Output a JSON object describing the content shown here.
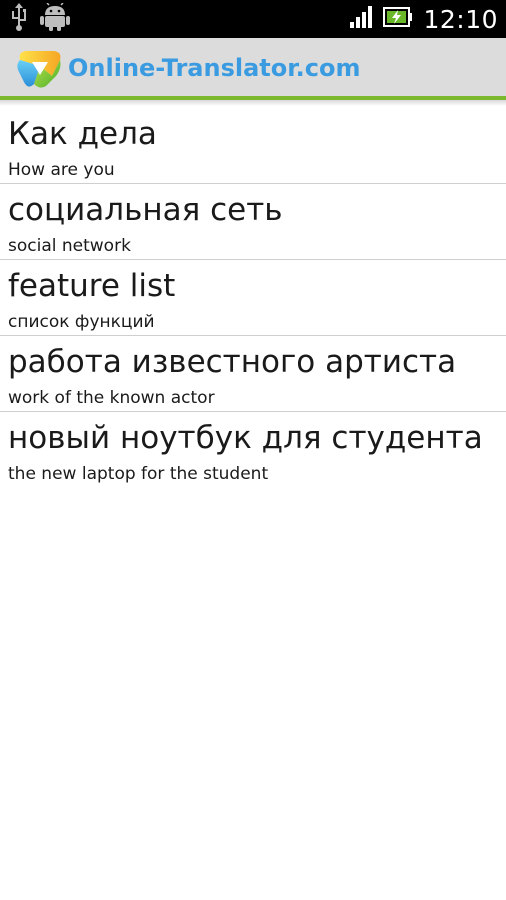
{
  "status_bar": {
    "time": "12:10",
    "icons": [
      "usb-icon",
      "android-debug-icon",
      "signal-icon",
      "battery-charging-icon"
    ]
  },
  "app_bar": {
    "title": "Online-Translator.com",
    "accent_color": "#7bb82e",
    "title_color": "#3a9be0"
  },
  "history": [
    {
      "source": "Как дела",
      "translation": "How are you"
    },
    {
      "source": "социальная сеть",
      "translation": "social network"
    },
    {
      "source": "feature list",
      "translation": "список функций"
    },
    {
      "source": "работа известного артиста",
      "translation": "work of the known actor"
    },
    {
      "source": "новый ноутбук для студента",
      "translation": "the new laptop for the student"
    }
  ]
}
